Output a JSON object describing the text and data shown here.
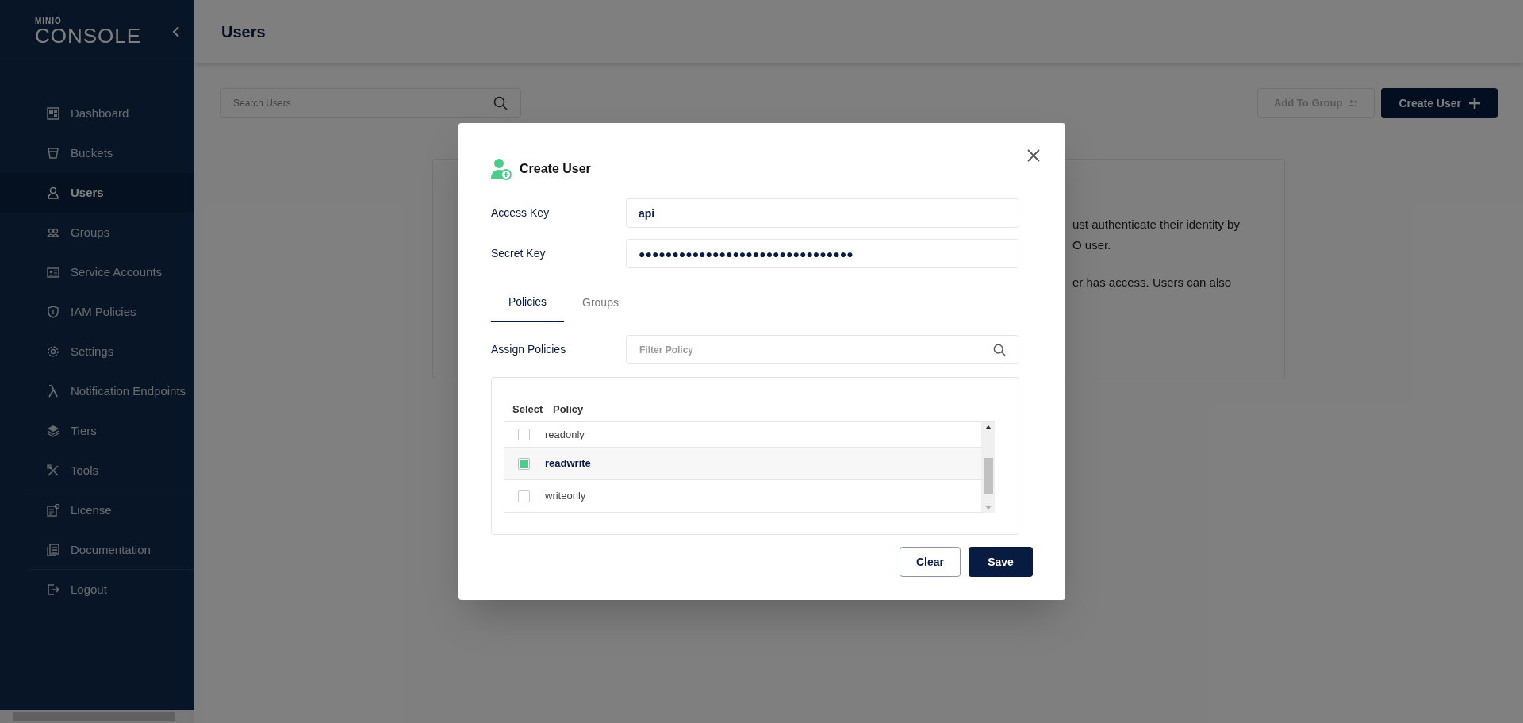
{
  "sidebar": {
    "logo_small": "MINIO",
    "logo": "CONSOLE",
    "sections": [
      {
        "items": [
          {
            "label": "Dashboard",
            "selected": false
          },
          {
            "label": "Buckets",
            "selected": false
          },
          {
            "label": "Users",
            "selected": true
          },
          {
            "label": "Groups",
            "selected": false
          },
          {
            "label": "Service Accounts",
            "selected": false
          },
          {
            "label": "IAM Policies",
            "selected": false
          },
          {
            "label": "Settings",
            "selected": false
          },
          {
            "label": "Notification Endpoints",
            "selected": false
          },
          {
            "label": "Tiers",
            "selected": false
          },
          {
            "label": "Tools",
            "selected": false
          }
        ]
      },
      {
        "items": [
          {
            "label": "License",
            "selected": false
          },
          {
            "label": "Documentation",
            "selected": false
          }
        ]
      },
      {
        "items": [
          {
            "label": "Logout",
            "selected": false
          }
        ]
      }
    ]
  },
  "header": {
    "title": "Users"
  },
  "toolbar": {
    "search_placeholder": "Search Users",
    "add_to_group": {
      "label": "Add To Group",
      "disabled": true
    },
    "create_user": "Create User"
  },
  "background_card": {
    "lines": [
      "ust authenticate their identity by",
      "O user.",
      "er has access. Users can also"
    ]
  },
  "dialog": {
    "title": "Create User",
    "fields": [
      {
        "label": "Access Key",
        "value": "api"
      },
      {
        "label": "Secret Key",
        "value": "●●●●●●●●●●●●●●●●●●●●●●●●●●●●●●●●"
      }
    ],
    "tabs": [
      {
        "label": "Policies",
        "selected": true
      },
      {
        "label": "Groups",
        "selected": false
      }
    ],
    "assign_label": "Assign Policies",
    "filter_placeholder": "Filter Policy",
    "table": {
      "columns": [
        "Select",
        "Policy"
      ],
      "rows": [
        {
          "policy": "readonly",
          "checked": false
        },
        {
          "policy": "readwrite",
          "checked": true
        },
        {
          "policy": "writeonly",
          "checked": false
        }
      ]
    },
    "buttons": {
      "clear": "Clear",
      "save": "Save"
    }
  }
}
